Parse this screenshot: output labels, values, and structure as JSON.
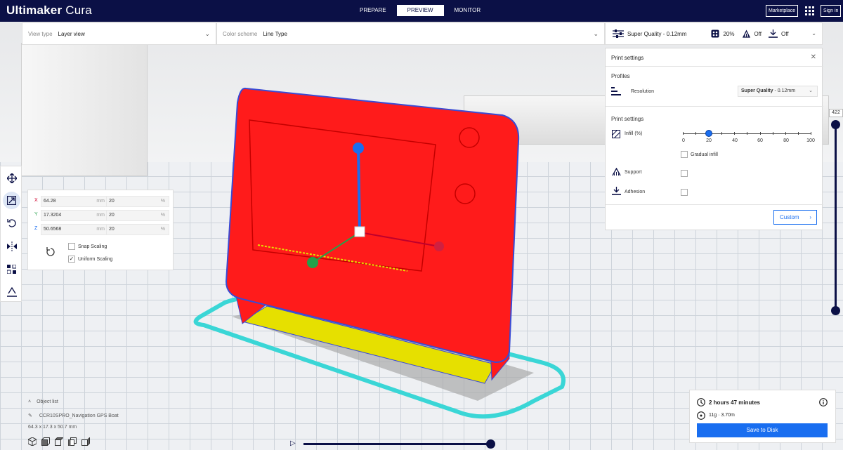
{
  "app": {
    "brand_bold": "Ultimaker",
    "brand_rest": "Cura"
  },
  "stages": [
    "PREPARE",
    "PREVIEW",
    "MONITOR"
  ],
  "stage_active": "PREVIEW",
  "topbar": {
    "marketplace": "Marketplace",
    "signin": "Sign in"
  },
  "view": {
    "label": "View type",
    "value": "Layer view"
  },
  "color_scheme": {
    "label": "Color scheme",
    "value": "Line Type"
  },
  "print_summary": {
    "profile": "Super Quality - 0.12mm",
    "infill": "20%",
    "support": "Off",
    "adhesion": "Off"
  },
  "print_settings": {
    "title": "Print settings",
    "profiles_label": "Profiles",
    "resolution_label": "Resolution",
    "profile_bold": "Super Quality",
    "profile_rest": " - 0.12mm",
    "section_label": "Print settings",
    "infill_label": "Infill (%)",
    "infill_ticks": [
      "0",
      "20",
      "40",
      "60",
      "80",
      "100"
    ],
    "infill_value": 20,
    "gradual_label": "Gradual infill",
    "support_label": "Support",
    "adhesion_label": "Adhesion",
    "custom_label": "Custom"
  },
  "layer": {
    "current": "422"
  },
  "scale": {
    "rows": [
      {
        "axis": "X",
        "mm": "64.28",
        "pct": "20"
      },
      {
        "axis": "Y",
        "mm": "17.3204",
        "pct": "20"
      },
      {
        "axis": "Z",
        "mm": "50.6568",
        "pct": "20"
      }
    ],
    "mm_unit": "mm",
    "pct_unit": "%",
    "snap_label": "Snap Scaling",
    "uniform_label": "Uniform Scaling"
  },
  "object_list": {
    "header": "Object list",
    "name": "CCR10SPRO_Navigation GPS Boat",
    "dims": "64.3 x 17.3 x 50.7 mm"
  },
  "estimate": {
    "time": "2 hours 47 minutes",
    "material": "11g · 3.70m",
    "save": "Save to Disk"
  },
  "colors": {
    "brand": "#0b1046",
    "accent": "#196ef0",
    "model": "#ff1b1b",
    "infill": "#e6e000",
    "brim": "#3ad6d6"
  }
}
